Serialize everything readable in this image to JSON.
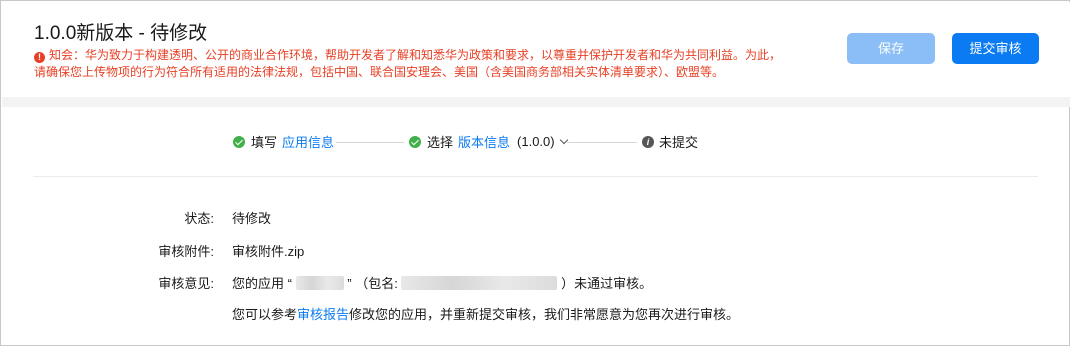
{
  "header": {
    "title": "1.0.0新版本 - 待修改",
    "notice_line1": "知会：华为致力于构建透明、公开的商业合作环境，帮助开发者了解和知悉华为政策和要求，以尊重并保护开发者和华为共同利益。为此，",
    "notice_line2": "请确保您上传物项的行为符合所有适用的法律法规，包括中国、联合国安理会、美国（含美国商务部相关实体清单要求）、欧盟等。",
    "save_label": "保存",
    "submit_label": "提交审核"
  },
  "steps": [
    {
      "prefix": "填写",
      "link": "应用信息",
      "status": "done"
    },
    {
      "prefix": "选择",
      "link": "版本信息",
      "version": "(1.0.0)",
      "status": "done"
    },
    {
      "prefix": "",
      "link": "",
      "label": "未提交",
      "status": "pending"
    }
  ],
  "details": {
    "status_label": "状态:",
    "status_value": "待修改",
    "attachment_label": "审核附件:",
    "attachment_value": "审核附件.zip",
    "opinion_label": "审核意见:",
    "opinion_prefix": "您的应用",
    "opinion_quote_open": "“",
    "opinion_quote_close": "”",
    "opinion_pkg_open": "（包名:",
    "opinion_pkg_close": "）未通过审核。",
    "opinion_line2_prefix": "您可以参考",
    "opinion_line2_link": "审核报告",
    "opinion_line2_suffix": "修改您的应用，并重新提交审核，我们非常愿意为您再次进行审核。"
  },
  "colors": {
    "accent": "#0a7bf3",
    "accent_disabled": "#8bbdf6",
    "warning": "#e84026",
    "success": "#42b04a"
  }
}
